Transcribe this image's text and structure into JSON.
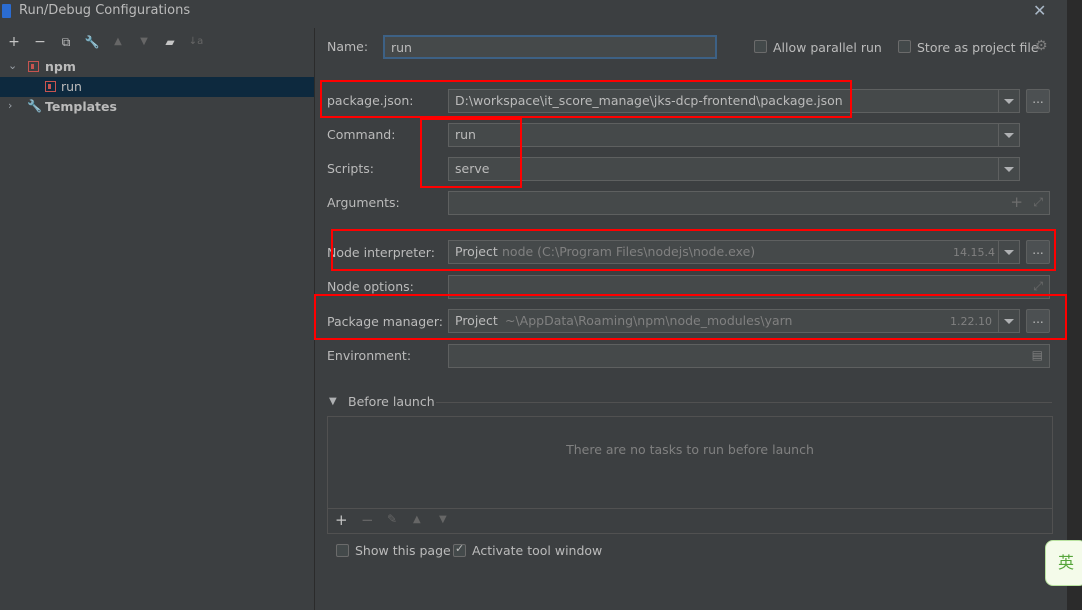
{
  "window": {
    "title": "Run/Debug Configurations"
  },
  "toolbar": {
    "add": "+",
    "remove": "−",
    "copy": "⧉",
    "edit": "🔧",
    "move_up": "▲",
    "move_down": "▼",
    "folder": "▰",
    "sort": "↓a"
  },
  "tree": {
    "npm": "npm",
    "run": "run",
    "templates": "Templates"
  },
  "form": {
    "name_label": "Name:",
    "name_value": "run",
    "allow_parallel_label": "Allow parallel run",
    "store_project_label": "Store as project file",
    "package_json_label": "package.json:",
    "package_json_value": "D:\\workspace\\it_score_manage\\jks-dcp-frontend\\package.json",
    "command_label": "Command:",
    "command_value": "run",
    "scripts_label": "Scripts:",
    "scripts_value": "serve",
    "arguments_label": "Arguments:",
    "node_interpreter_label": "Node interpreter:",
    "node_interpreter_kind": "Project",
    "node_interpreter_path": "node (C:\\Program Files\\nodejs\\node.exe)",
    "node_version": "14.15.4",
    "node_options_label": "Node options:",
    "package_manager_label": "Package manager:",
    "package_manager_kind": "Project",
    "package_manager_path": "~\\AppData\\Roaming\\npm\\node_modules\\yarn",
    "package_manager_version": "1.22.10",
    "environment_label": "Environment:",
    "browse": "..."
  },
  "before_launch": {
    "title": "Before launch",
    "empty_text": "There are no tasks to run before launch"
  },
  "footer": {
    "show_page_label": "Show this page",
    "activate_tool_label": "Activate tool window"
  },
  "ime": {
    "label": "英"
  }
}
